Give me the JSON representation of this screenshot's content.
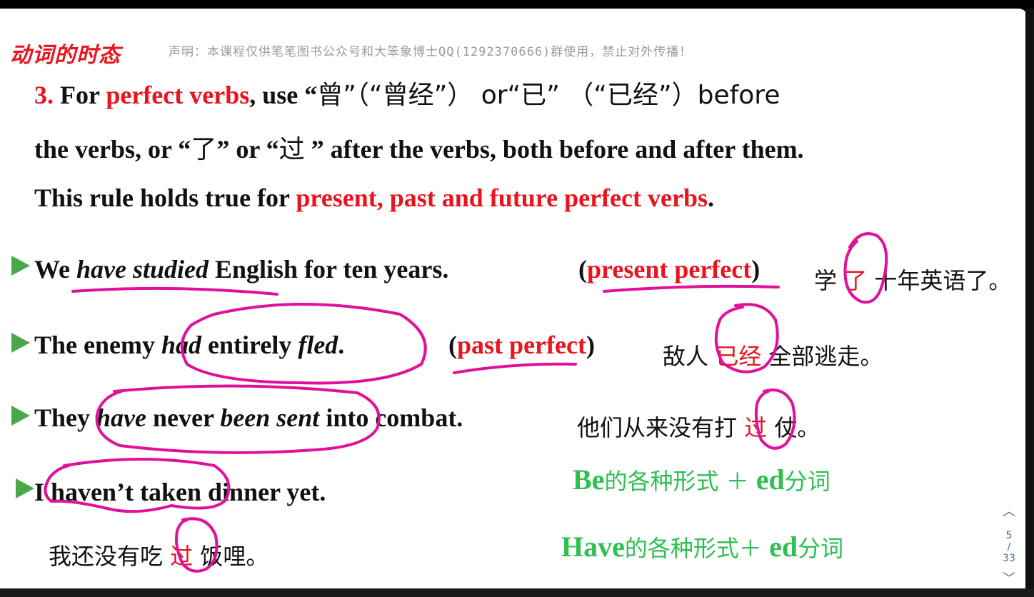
{
  "header": {
    "title": "动词的时态",
    "notice": "声明：本课程仅供笔笔图书公众号和大笨象博士QQ(1292370666)群使用，禁止对外传播！"
  },
  "rule": {
    "line1": {
      "num": "3.",
      "a": " For ",
      "b": "perfect verbs",
      "c": ", use “",
      "d": "曾",
      "e": "”（“",
      "f": "曾经",
      "g": "”） or“",
      "h": "已",
      "i": "” （“",
      "j": "已经",
      "k": "”）before"
    },
    "line2": {
      "a": "the verbs, or “",
      "b": "了",
      "c": "” or “",
      "d": "过",
      "e": " ” after the verbs, both before and after them."
    },
    "line3": {
      "a": "This rule holds true for ",
      "b": "present, past and future perfect verbs",
      "c": "."
    }
  },
  "examples": [
    {
      "parts": [
        "We ",
        "have studied",
        " English for ten years."
      ],
      "tense_open": "(",
      "tense": "present perfect",
      "tense_close": ")",
      "zh_a": "学",
      "zh_mark": "了",
      "zh_b": "十年英语了。"
    },
    {
      "parts": [
        "The enemy ",
        "had",
        " entirely ",
        "fled",
        "."
      ],
      "tense_open": "(",
      "tense": "past perfect",
      "tense_close": ")",
      "zh_a": "敌人",
      "zh_mark": "已经",
      "zh_b": "全部逃走。"
    },
    {
      "parts": [
        "They ",
        "have",
        " never ",
        "been sent",
        " into combat."
      ],
      "zh_a": "他们从来没有打",
      "zh_mark": "过",
      "zh_b": "仗。"
    },
    {
      "parts": [
        "I haven’t taken dinner yet."
      ],
      "zh_a": "我还没有吃",
      "zh_mark": "过",
      "zh_b": "饭哩。"
    }
  ],
  "formulas": {
    "be": {
      "a": "Be",
      "b": "的各种形式 ＋ ",
      "c": "ed",
      "d": "分词"
    },
    "have": {
      "a": "Have",
      "b": "的各种形式＋ ",
      "c": "ed",
      "d": "分词"
    }
  },
  "pager": {
    "up": "︿",
    "current": "5",
    "sep": "/",
    "total": "33",
    "down": "﹀"
  },
  "colors": {
    "red": "#e8141e",
    "green": "#2fbf52",
    "bullet": "#4aa84a",
    "ink": "#e0109a"
  }
}
